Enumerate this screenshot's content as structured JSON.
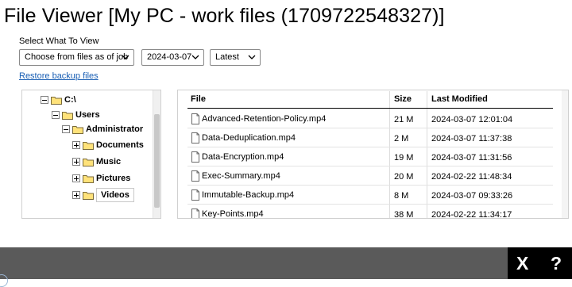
{
  "header": {
    "title": "File Viewer [My PC - work files (1709722548327)]"
  },
  "filters": {
    "label": "Select What To View",
    "mode": "Choose from files as of job",
    "date": "2024-03-07",
    "version": "Latest"
  },
  "restore_link": "Restore backup files",
  "tree": {
    "root": "C:\\",
    "users": "Users",
    "administrator": "Administrator",
    "documents": "Documents",
    "music": "Music",
    "pictures": "Pictures",
    "videos": "Videos"
  },
  "files": {
    "columns": {
      "file": "File",
      "size": "Size",
      "modified": "Last Modified"
    },
    "rows": [
      {
        "name": "Advanced-Retention-Policy.mp4",
        "size": "21 M",
        "modified": "2024-03-07 12:01:04"
      },
      {
        "name": "Data-Deduplication.mp4",
        "size": "2 M",
        "modified": "2024-03-07 11:37:38"
      },
      {
        "name": "Data-Encryption.mp4",
        "size": "19 M",
        "modified": "2024-03-07 11:31:56"
      },
      {
        "name": "Exec-Summary.mp4",
        "size": "20 M",
        "modified": "2024-02-22 11:48:34"
      },
      {
        "name": "Immutable-Backup.mp4",
        "size": "8 M",
        "modified": "2024-03-07 09:33:26"
      },
      {
        "name": "Key-Points.mp4",
        "size": "38 M",
        "modified": "2024-02-22 11:34:17"
      }
    ]
  },
  "bottom_bar": {
    "close_label": "X",
    "help_label": "?"
  },
  "colors": {
    "link": "#1a5fb4",
    "bar": "#5a5a5a",
    "bar_dark": "#000000",
    "folder": "#ffe27a"
  }
}
